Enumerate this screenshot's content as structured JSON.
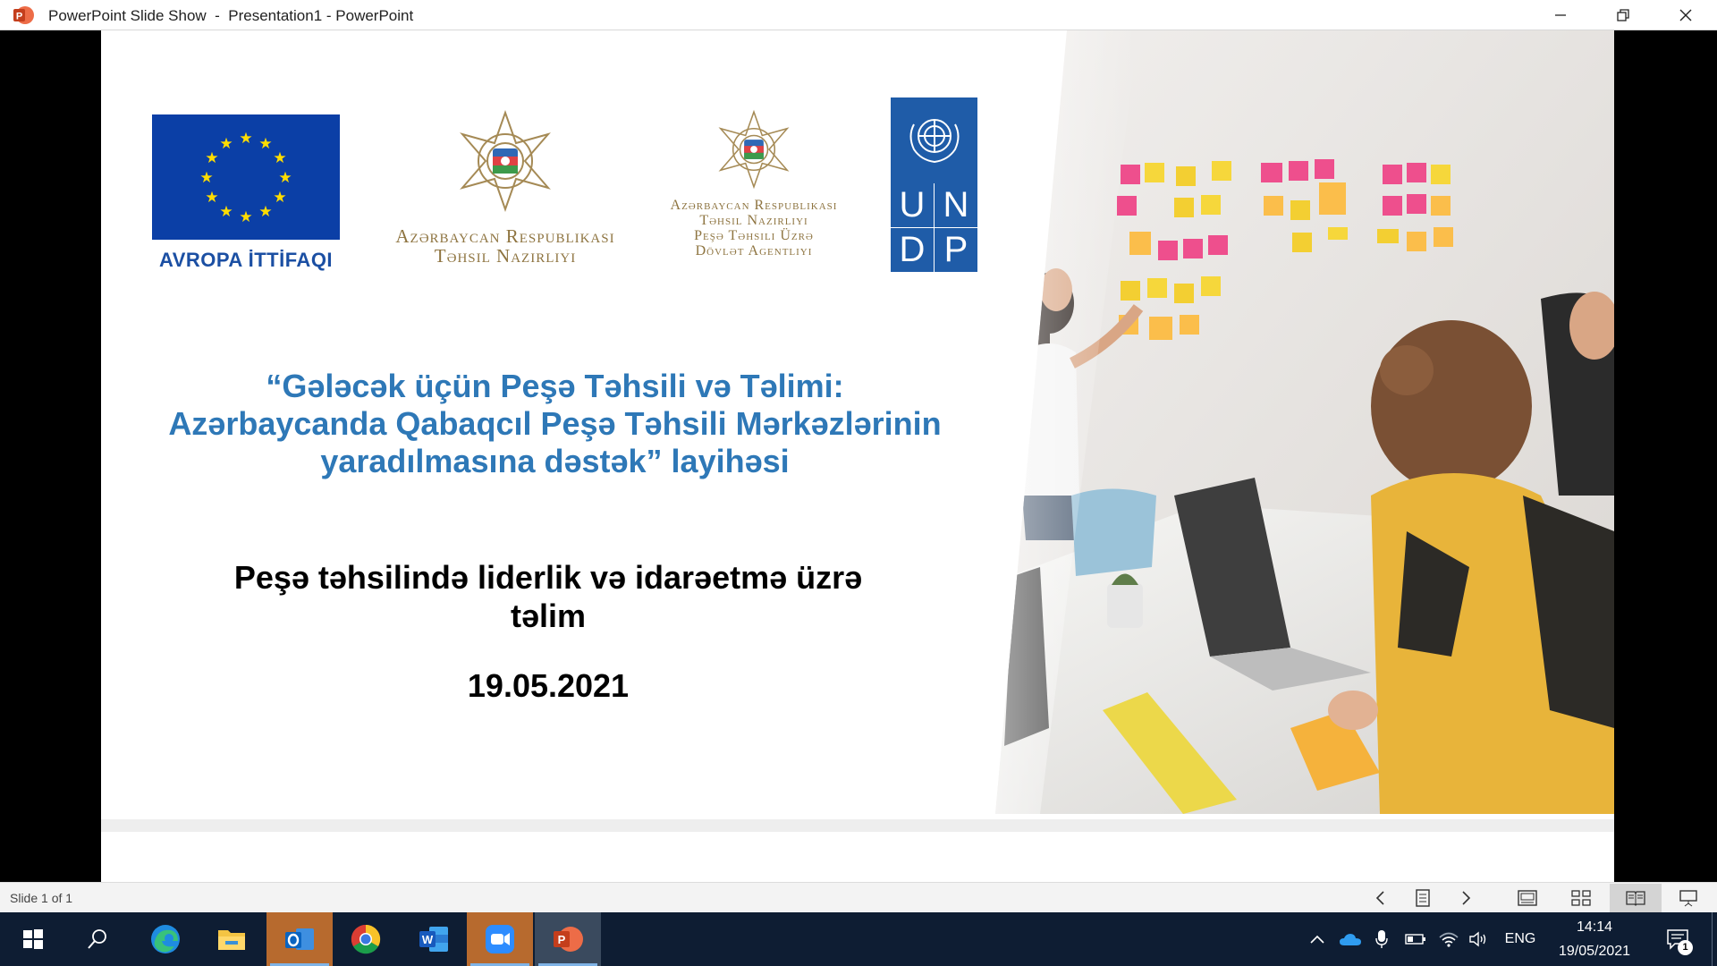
{
  "window": {
    "title": "PowerPoint Slide Show  -  Presentation1 - PowerPoint"
  },
  "slide": {
    "logos": {
      "eu_label": "AVROPA İTTİFAQI",
      "ministry_lines": [
        "Azərbaycan Respublikası",
        "Təhsil Nazirliyi"
      ],
      "agency_lines": [
        "Azərbaycan Respublikası",
        "Təhsil Nazirliyi",
        "Peşə Təhsili Üzrə",
        "Dövlət Agentliyi"
      ],
      "undp_letters": [
        "U",
        "N",
        "D",
        "P"
      ]
    },
    "headline_lines": [
      "“Gələcək üçün Peşə Təhsili və Təlimi:",
      "Azərbaycanda Qabaqcıl Peşə Təhsili Mərkəzlərinin",
      "yaradılmasına dəstək” layihəsi"
    ],
    "subtitle_lines": [
      "Peşə təhsilində liderlik və idarəetmə üzrə",
      "təlim"
    ],
    "date": "19.05.2021"
  },
  "statusbar": {
    "slide_counter": "Slide 1 of 1"
  },
  "taskbar": {
    "language": "ENG",
    "time": "14:14",
    "date": "19/05/2021",
    "notification_count": "1"
  },
  "colors": {
    "headline": "#2e78b7",
    "eu_blue": "#0b3fa6",
    "undp_blue": "#1f5ca8",
    "ministry_gold": "#8e7440",
    "taskbar": "#0e1d33",
    "powerpoint_red": "#c43e1c"
  },
  "icons": {
    "app": "powerpoint-icon",
    "window_controls": [
      "minimize-icon",
      "restore-icon",
      "close-icon"
    ],
    "statusbar": [
      "chevron-left-icon",
      "slide-menu-icon",
      "chevron-right-icon",
      "normal-view-icon",
      "slide-sorter-icon",
      "reading-view-icon",
      "slideshow-icon"
    ],
    "taskbar_apps": [
      "windows-start-icon",
      "search-icon",
      "edge-icon",
      "file-explorer-icon",
      "outlook-icon",
      "chrome-icon",
      "word-icon",
      "zoom-icon",
      "powerpoint-icon"
    ],
    "tray": [
      "chevron-up-icon",
      "onedrive-icon",
      "microphone-icon",
      "battery-icon",
      "wifi-icon",
      "volume-icon",
      "notification-icon"
    ]
  }
}
